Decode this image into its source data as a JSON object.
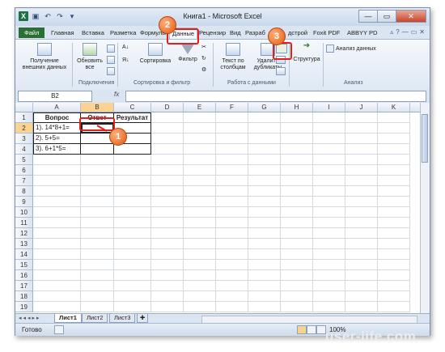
{
  "window": {
    "title": "Книга1  -  Microsoft Excel",
    "buttons": [
      "—",
      "▭",
      "✕"
    ]
  },
  "qat_icons": [
    "excel-app-icon",
    "save-icon",
    "undo-icon",
    "redo-icon",
    "customize-icon"
  ],
  "tabs": [
    "Файл",
    "Главная",
    "Вставка",
    "Разметка",
    "Формулы",
    "Данные",
    "Рецензир",
    "Вид",
    "Разраб",
    "дстрой",
    "Foxit PDF",
    "ABBYY PD"
  ],
  "active_tab": "Данные",
  "ribbon": {
    "get_external": "Получение внешних данных",
    "refresh_all": "Обновить все",
    "connections_group": "Подключения",
    "sort": "Сортировка",
    "filter": "Фильтр",
    "sort_filter_group": "Сортировка и фильтр",
    "text_to_columns": "Текст по столбцам",
    "remove_duplicates": "Удалить дубликаты",
    "data_tools_group": "Работа с данными",
    "structure": "Структура",
    "analysis": "Анализ данных",
    "analysis_group": "Анализ"
  },
  "formula_bar": {
    "name_box": "B2",
    "fx": "fx",
    "value": ""
  },
  "columns": [
    "A",
    "B",
    "C",
    "D",
    "E",
    "F",
    "G",
    "H",
    "I",
    "J",
    "K"
  ],
  "rows": [
    "1",
    "2",
    "3",
    "4",
    "5",
    "6",
    "7",
    "8",
    "9",
    "10",
    "11",
    "12",
    "13",
    "14",
    "15",
    "16",
    "17",
    "18",
    "19"
  ],
  "cells": {
    "A1": "Вопрос",
    "B1": "Ответ",
    "C1": "Результат",
    "A2": "1). 14*8+1=",
    "A3": "2). 5+5=",
    "A4": "3). 6+1*5="
  },
  "sheets": [
    "Лист1",
    "Лист2",
    "Лист3"
  ],
  "status": {
    "ready": "Готово",
    "zoom": "100%"
  },
  "callouts": [
    "1",
    "2",
    "3"
  ],
  "watermark": "user-life.com"
}
